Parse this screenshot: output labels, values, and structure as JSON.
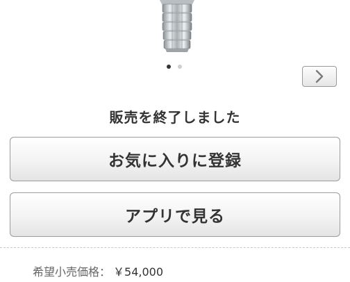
{
  "product": {
    "image_alt_icon": "wristwatch-bracelet-icon"
  },
  "carousel": {
    "dots": 2,
    "active_index": 0,
    "next_icon": "chevron-right-icon"
  },
  "status": {
    "text": "販売を終了しました"
  },
  "actions": {
    "favorite_label": "お気に入りに登録",
    "app_label": "アプリで見る"
  },
  "price": {
    "label": "希望小売価格：",
    "value": "￥54,000"
  },
  "colors": {
    "text": "#333333",
    "button_border": "#9c9c9c",
    "dot_active": "#333333",
    "dot_inactive": "#cfcfcf"
  }
}
